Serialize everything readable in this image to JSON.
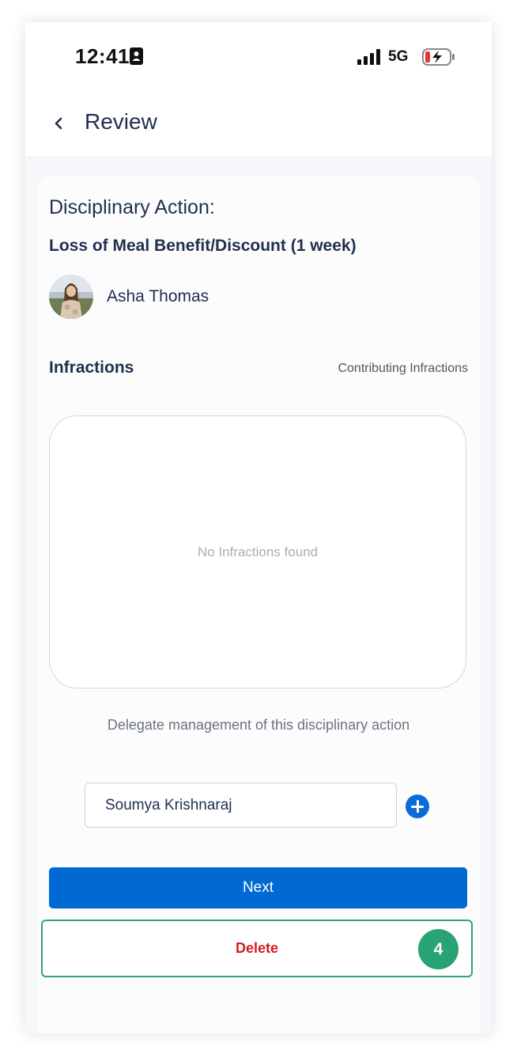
{
  "status_bar": {
    "time": "12:41",
    "network": "5G"
  },
  "header": {
    "title": "Review"
  },
  "card": {
    "section_label": "Disciplinary Action:",
    "action_name": "Loss of Meal Benefit/Discount (1 week)",
    "employee_name": "Asha Thomas",
    "infractions_heading": "Infractions",
    "contributing_link": "Contributing Infractions",
    "empty_message": "No Infractions found",
    "delegate_text": "Delegate management of this disciplinary action",
    "delegate_value": "Soumya Krishnaraj",
    "next_label": "Next",
    "delete_label": "Delete",
    "step_badge": "4"
  },
  "colors": {
    "primary": "#0069d3",
    "delete_text": "#d51c1c",
    "highlight": "#27a374",
    "title_text": "#1f2f4e"
  },
  "icons": {
    "back": "chevron-left-icon",
    "add": "plus-circle-icon",
    "status_id": "id-badge-icon",
    "status_signal": "signal-bars-icon",
    "status_battery": "battery-charging-icon"
  }
}
